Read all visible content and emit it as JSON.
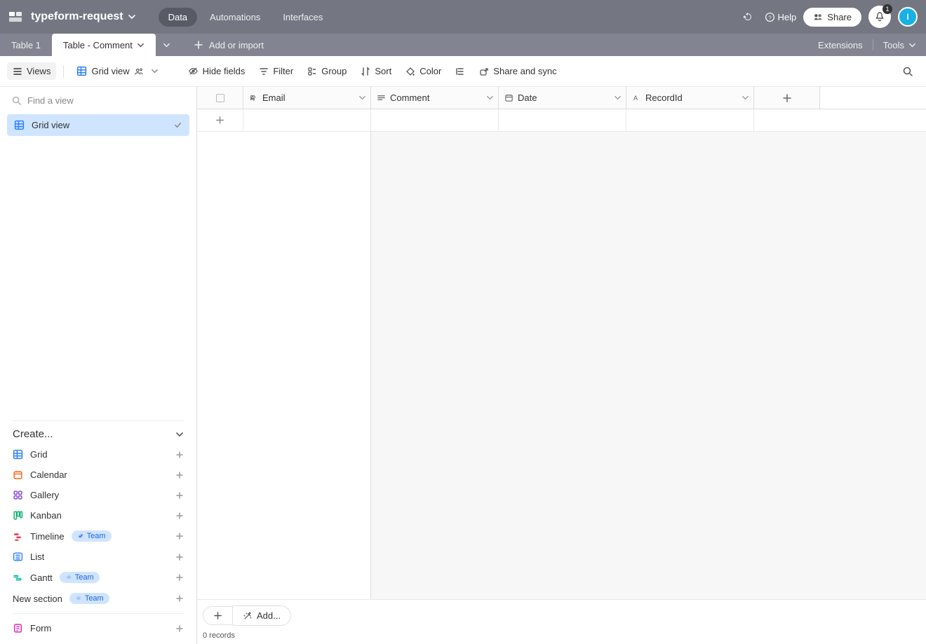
{
  "topbar": {
    "base_name": "typeform-request",
    "nav": {
      "data": "Data",
      "automations": "Automations",
      "interfaces": "Interfaces"
    },
    "help": "Help",
    "share": "Share",
    "notif_count": "1",
    "avatar_initial": "I"
  },
  "tabs": {
    "tab1": "Table 1",
    "tab2": "Table - Comment",
    "add": "Add or import",
    "extensions": "Extensions",
    "tools": "Tools"
  },
  "toolbar": {
    "views": "Views",
    "grid_view": "Grid view",
    "hide_fields": "Hide fields",
    "filter": "Filter",
    "group": "Group",
    "sort": "Sort",
    "color": "Color",
    "share_sync": "Share and sync"
  },
  "sidebar": {
    "find_placeholder": "Find a view",
    "view_item": "Grid view",
    "create_header": "Create...",
    "options": {
      "grid": "Grid",
      "calendar": "Calendar",
      "gallery": "Gallery",
      "kanban": "Kanban",
      "timeline": "Timeline",
      "list": "List",
      "gantt": "Gantt",
      "new_section": "New section",
      "form": "Form"
    },
    "team_label": "Team"
  },
  "columns": {
    "email": "Email",
    "comment": "Comment",
    "date": "Date",
    "recordid": "RecordId"
  },
  "footer": {
    "add": "Add...",
    "records": "0 records"
  }
}
